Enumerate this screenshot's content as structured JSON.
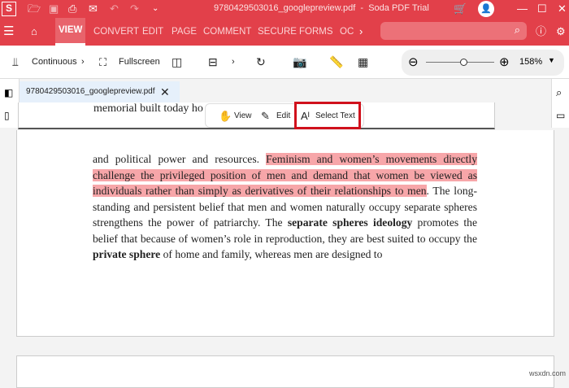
{
  "window": {
    "title": "9780429503016_googlepreview.pdf  -  Soda PDF Trial",
    "app_icon": "S"
  },
  "tabs": [
    "VIEW",
    "CONVERT",
    "EDIT",
    "PAGE",
    "COMMENT",
    "SECURE",
    "FORMS",
    "OC"
  ],
  "toolbar": {
    "continuous": "Continuous",
    "fullscreen": "Fullscreen",
    "zoom": "158%"
  },
  "doc_tab": {
    "name": "9780429503016_googlepreview.pdf"
  },
  "float_toolbar": {
    "view": "View",
    "edit": "Edit",
    "select_text": "Select Text"
  },
  "page_top": {
    "text": "memorial built today ho"
  },
  "paragraph": {
    "p1": "and political power and resources. ",
    "hl": "Feminism and women’s movements directly challenge the privileged position of men and demand that women be viewed as individuals rather than simply as derivatives of their relationships to men",
    "p2": ". The long-standing and persistent belief that men and women naturally occupy separate spheres strengthens the power of patriarchy. The ",
    "b1": "separate spheres ideology",
    "p3": " promotes the belief that because of women’s role in reproduction, they are best suited to occupy the ",
    "b2": "private sphere",
    "p4": " of home and family, whereas men are designed to"
  },
  "watermark": "wsxdn.com"
}
